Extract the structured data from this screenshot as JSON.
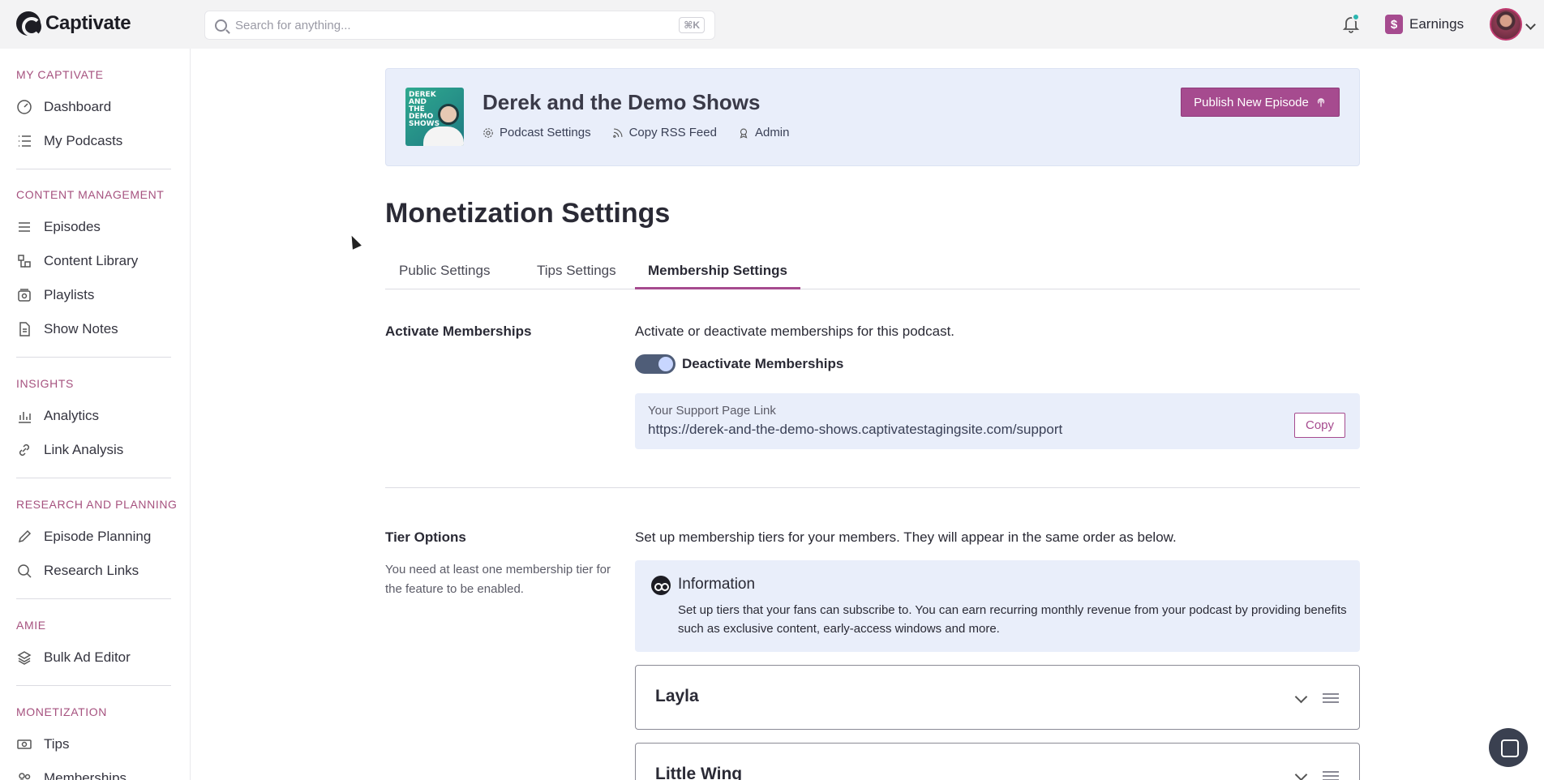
{
  "app": {
    "logo_text": "Captivate"
  },
  "search": {
    "placeholder": "Search for anything...",
    "shortcut": "⌘K"
  },
  "topbar": {
    "earnings_label": "Earnings",
    "earnings_icon": "dollar-icon"
  },
  "sidebar": {
    "sections": [
      {
        "title": "MY CAPTIVATE",
        "items": [
          {
            "label": "Dashboard",
            "icon": "gauge-icon"
          },
          {
            "label": "My Podcasts",
            "icon": "list-icon"
          }
        ]
      },
      {
        "title": "CONTENT MANAGEMENT",
        "items": [
          {
            "label": "Episodes",
            "icon": "lines-icon"
          },
          {
            "label": "Content Library",
            "icon": "library-icon"
          },
          {
            "label": "Playlists",
            "icon": "playlist-icon"
          },
          {
            "label": "Show Notes",
            "icon": "document-icon"
          }
        ]
      },
      {
        "title": "INSIGHTS",
        "items": [
          {
            "label": "Analytics",
            "icon": "bar-chart-icon"
          },
          {
            "label": "Link Analysis",
            "icon": "link-icon"
          }
        ]
      },
      {
        "title": "RESEARCH AND PLANNING",
        "items": [
          {
            "label": "Episode Planning",
            "icon": "pencil-icon"
          },
          {
            "label": "Research Links",
            "icon": "search-doc-icon"
          }
        ]
      },
      {
        "title": "AMIE",
        "items": [
          {
            "label": "Bulk Ad Editor",
            "icon": "layers-icon"
          }
        ]
      },
      {
        "title": "MONETIZATION",
        "items": [
          {
            "label": "Tips",
            "icon": "money-icon"
          },
          {
            "label": "Memberships",
            "icon": "users-icon"
          }
        ]
      }
    ]
  },
  "show": {
    "cover_text": "DEREK AND THE DEMO SHOWS",
    "title": "Derek and the Demo Shows",
    "links": [
      {
        "label": "Podcast Settings",
        "icon": "gear-icon"
      },
      {
        "label": "Copy RSS Feed",
        "icon": "rss-icon"
      },
      {
        "label": "Admin",
        "icon": "badge-icon"
      }
    ],
    "publish_label": "Publish New Episode"
  },
  "page": {
    "title": "Monetization Settings",
    "tabs": [
      {
        "label": "Public Settings"
      },
      {
        "label": "Tips Settings"
      },
      {
        "label": "Membership Settings"
      }
    ],
    "active_tab": "Membership Settings"
  },
  "activate": {
    "heading": "Activate Memberships",
    "description": "Activate or deactivate memberships for this podcast.",
    "toggle_label": "Deactivate Memberships",
    "toggle_on": true,
    "support_label": "Your Support Page Link",
    "support_url": "https://derek-and-the-demo-shows.captivatestagingsite.com/support",
    "copy_label": "Copy"
  },
  "tiers": {
    "heading": "Tier Options",
    "note": "You need at least one membership tier for the feature to be enabled.",
    "description": "Set up membership tiers for your members. They will appear in the same order as below.",
    "info_title": "Information",
    "info_text": "Set up tiers that your fans can subscribe to. You can earn recurring monthly revenue from your podcast by providing benefits such as exclusive content, early-access windows and more.",
    "items": [
      {
        "name": "Layla"
      },
      {
        "name": "Little Wing"
      }
    ]
  },
  "colors": {
    "accent": "#a64b8f",
    "info_bg": "#e9eefa",
    "toggle_bg": "#4f5d78"
  }
}
